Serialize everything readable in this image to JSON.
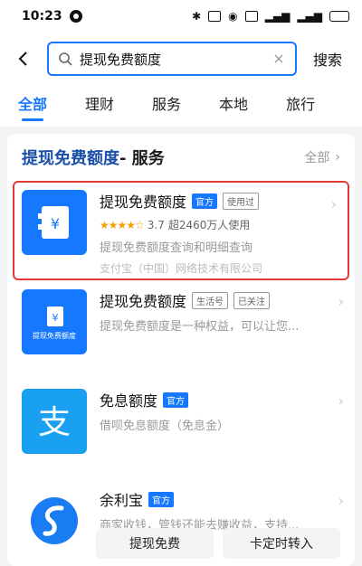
{
  "status_bar": {
    "time": "10:23"
  },
  "header": {
    "search_value": "提现免费额度",
    "search_button": "搜索"
  },
  "tabs": [
    "全部",
    "理财",
    "服务",
    "本地",
    "旅行"
  ],
  "section": {
    "query": "提现免费额度",
    "suffix": " - 服务",
    "all_label": "全部"
  },
  "results": [
    {
      "name": "提现免费额度",
      "badges": [
        "官方",
        "使用过"
      ],
      "rating": "3.7",
      "users": "超2460万人使用",
      "desc": "提现免费额度查询和明细查询",
      "company": "支付宝（中国）网络技术有限公司"
    },
    {
      "name": "提现免费额度",
      "badges": [
        "生活号",
        "已关注"
      ],
      "logo_text": "提现免费额度",
      "desc": "提现免费额度是一种权益，可以让您..."
    },
    {
      "name": "免息额度",
      "badges": [
        "官方"
      ],
      "desc": "借呗免息额度（免息金）"
    },
    {
      "name": "余利宝",
      "badges": [
        "官方"
      ],
      "desc": "商家收钱，管钱还能去赚收益，支持..."
    }
  ],
  "actions": [
    "提现免费",
    "卡定时转入"
  ],
  "colors": {
    "accent": "#1677ff",
    "highlight": "#e53935",
    "star": "#f4a100"
  }
}
